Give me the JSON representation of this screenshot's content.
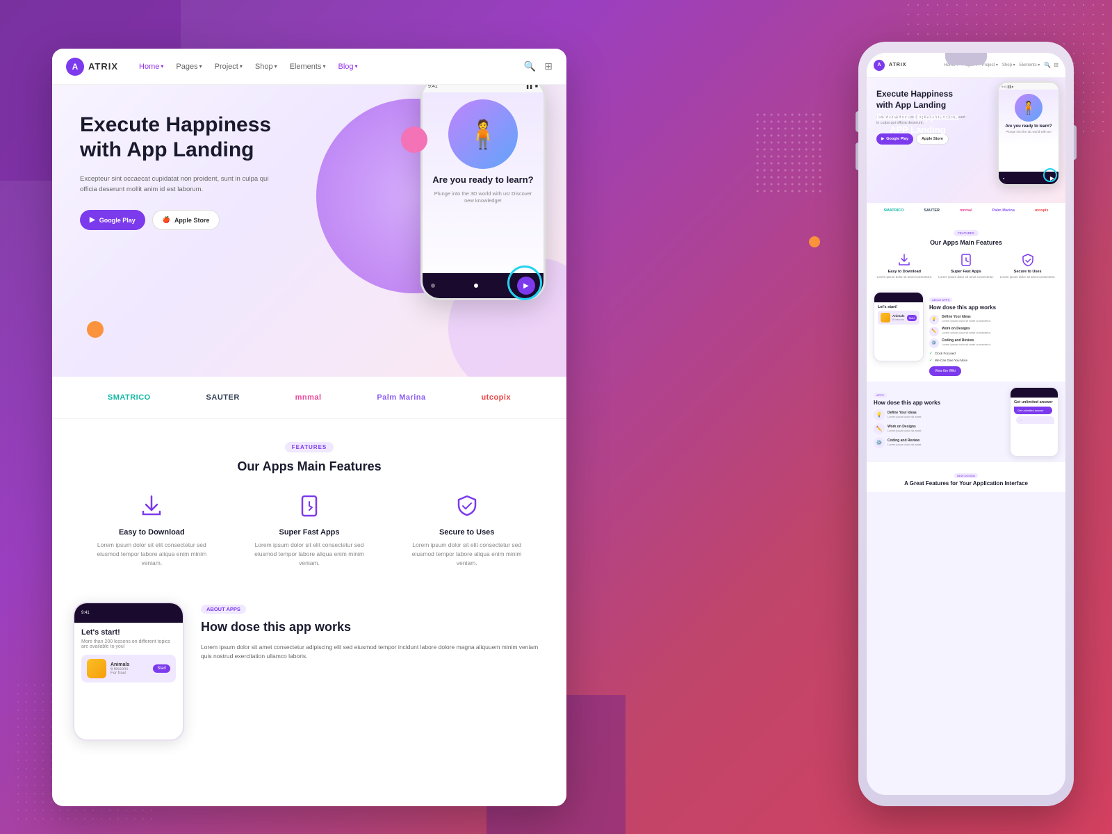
{
  "background": {
    "gradient_start": "#7b3fa0",
    "gradient_end": "#d44060"
  },
  "left_browser": {
    "nav": {
      "logo_letter": "A",
      "logo_text": "ATRIX",
      "links": [
        {
          "label": "Home",
          "has_chevron": true,
          "active": true
        },
        {
          "label": "Pages",
          "has_chevron": true
        },
        {
          "label": "Project",
          "has_chevron": true
        },
        {
          "label": "Shop",
          "has_chevron": true
        },
        {
          "label": "Elements",
          "has_chevron": true
        },
        {
          "label": "Blog",
          "has_chevron": true
        }
      ]
    },
    "hero": {
      "title": "Execute Happiness with App Landing",
      "description": "Excepteur sint occaecat cupidatat non proident, sunt in culpa qui officia deserunt mollit anim id est laborum.",
      "btn_play_label": "Google Play",
      "btn_apple_label": "Apple Store",
      "phone_question": "Are you ready to learn?",
      "phone_sub": "Plunge into the 3D world with us! Discover new knowledge!"
    },
    "brands": [
      "SMATRICO",
      "SAUTER",
      "mnmal",
      "Palm Marina",
      "utcopix"
    ],
    "features": {
      "badge": "FEATURES",
      "title": "Our Apps Main Features",
      "items": [
        {
          "name": "Easy to Download",
          "desc": "Lorem ipsum dolor sit elit consectetur sed eiusmod tempor labore aliqua enim minim veniam."
        },
        {
          "name": "Super Fast Apps",
          "desc": "Lorem ipsum dolor sit elit consectetur sed eiusmod tempor labore aliqua enim minim veniam."
        },
        {
          "name": "Secure to Uses",
          "desc": "Lorem ipsum dolor sit elit consectetur sed eiusmod tempor labore aliqua enim minim veniam."
        }
      ]
    },
    "about": {
      "badge": "ABOUT APPS",
      "title": "How dose this app works",
      "desc": "Lorem ipsum dolor sit amet consectetur adipiscing elit sed eiusmod tempor incidunt labore dolore magna aliquuem minim veniam quis nostrud exercitation ullamco laboris.",
      "phone_title": "Let's start!",
      "phone_sub": "More than 200 lessons on different topics are available to you!",
      "card_title": "Animals",
      "card_sub": "6 lessons",
      "card_price": "For free!",
      "card_btn": "Start"
    }
  },
  "right_device": {
    "nav": {
      "logo_letter": "A",
      "logo_text": "ATRIX",
      "links": [
        "Home",
        "Pages",
        "Project",
        "Shop",
        "Elements"
      ]
    },
    "hero": {
      "title": "Execute Happiness with App Landing",
      "desc": "Excepteur sint occaecat cupidatat non proident, sunt in culpa qui officia deserunt.",
      "btn_play": "Google Play",
      "btn_apple": "Apple Store",
      "phone_question": "Are you ready to learn?",
      "phone_sub": "Plunge into the 3D world with us!"
    },
    "brands": [
      "SMATRICO",
      "SAUTER",
      "mnmal",
      "Palm Marina",
      "utcopix"
    ],
    "features": {
      "badge": "FEATURES",
      "title": "Our Apps Main Features",
      "items": [
        {
          "name": "Easy to Download",
          "desc": "Lorem ipsum dolor sit amet consectetur."
        },
        {
          "name": "Super Fast Apps",
          "desc": "Lorem ipsum dolor sit amet consectetur."
        },
        {
          "name": "Secure to Uses",
          "desc": "Lorem ipsum dolor sit amet consectetur."
        }
      ]
    },
    "about": {
      "badge": "ABOUT APPS",
      "title": "How dose this app works",
      "steps": [
        {
          "title": "Define Your Ideas",
          "desc": "Lorem ipsum dolor sit amet consectetur."
        },
        {
          "title": "Work on Designs",
          "desc": "Lorem ipsum dolor sit amet consectetur."
        },
        {
          "title": "Coding and Review",
          "desc": "Lorem ipsum dolor sit amet consectetur."
        }
      ],
      "checks": [
        "Clock Focused",
        "We Can Give You More"
      ],
      "btn": "View the Wiki"
    },
    "how_works": {
      "badge": "APPS",
      "title": "How dose this app works",
      "chat_bubble1": "Get unlimited answer",
      "chat_bubble2": "..."
    },
    "bottom": {
      "badge": "NEW DESIGN",
      "title": "A Great Features for Your Application Interface"
    }
  },
  "screenshot_label": {
    "line1": "Execute Happiness",
    "line2": "APP Landing"
  }
}
